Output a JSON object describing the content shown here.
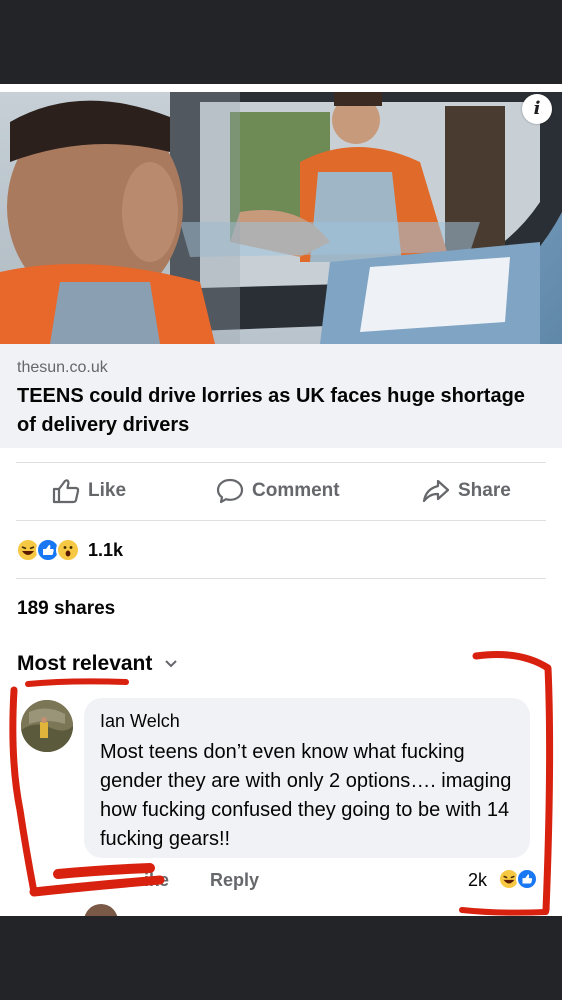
{
  "preview": {
    "info_icon": "i"
  },
  "link": {
    "domain": "thesun.co.uk",
    "title": "TEENS could drive lorries as UK faces huge shortage of delivery drivers"
  },
  "actions": {
    "like_label": "Like",
    "comment_label": "Comment",
    "share_label": "Share",
    "like_icon": "thumbs-up-icon",
    "comment_icon": "speech-bubble-icon",
    "share_icon": "share-arrow-icon"
  },
  "reactions": {
    "types": [
      "haha",
      "like",
      "wow"
    ],
    "count": "1.1k"
  },
  "shares": "189 shares",
  "sort": {
    "label": "Most relevant",
    "icon": "chevron-down-icon"
  },
  "comment": {
    "author": "Ian Welch",
    "text": "Most teens don’t even know what fucking gender they are with only 2 options…. imaging how fucking confused they going to be with 14 fucking gears!!",
    "like_label": "ike",
    "reply_label": "Reply",
    "reaction_count": "2k",
    "reaction_types": [
      "haha",
      "like"
    ]
  },
  "colors": {
    "facebook_blue": "#1877f2",
    "secondary_text": "#65676b",
    "annotation_red": "#d8210f",
    "bubble_bg": "#f0f2f5"
  }
}
